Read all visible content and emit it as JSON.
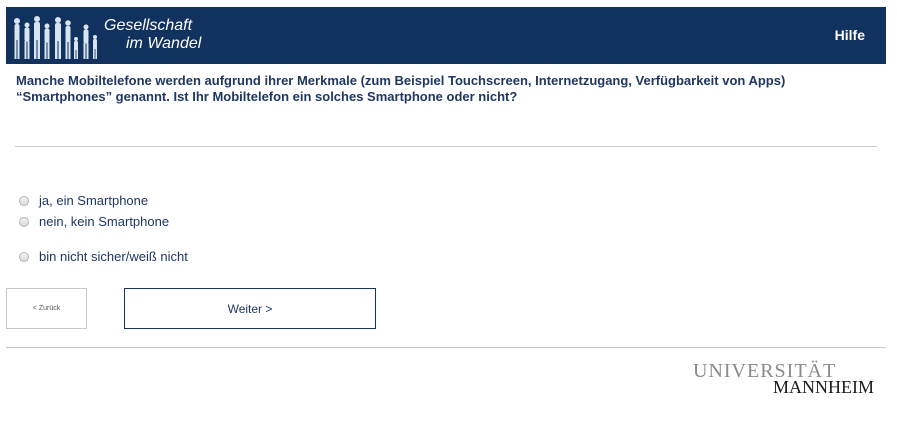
{
  "header": {
    "logo_line1": "Gesellschaft",
    "logo_line2": "im Wandel",
    "help_label": "Hilfe",
    "background_color": "#11325f"
  },
  "question": {
    "line1": "Manche Mobiltelefone werden aufgrund ihrer Merkmale (zum Beispiel Touchscreen, Internetzugang, Verfügbarkeit von Apps)",
    "line2": "“Smartphones” genannt. Ist Ihr Mobiltelefon ein solches Smartphone oder nicht?"
  },
  "options": [
    {
      "label": "ja, ein Smartphone",
      "selected": false
    },
    {
      "label": "nein, kein Smartphone",
      "selected": false
    },
    {
      "label": "bin nicht sicher/weiß nicht",
      "selected": false
    }
  ],
  "navigation": {
    "back_label": "< Zurück",
    "next_label": "Weiter >"
  },
  "footer": {
    "university_line1": "UNIVERSITÄT",
    "university_line2": "MANNHEIM"
  },
  "icons": {
    "logo": "people-silhouettes-icon"
  }
}
